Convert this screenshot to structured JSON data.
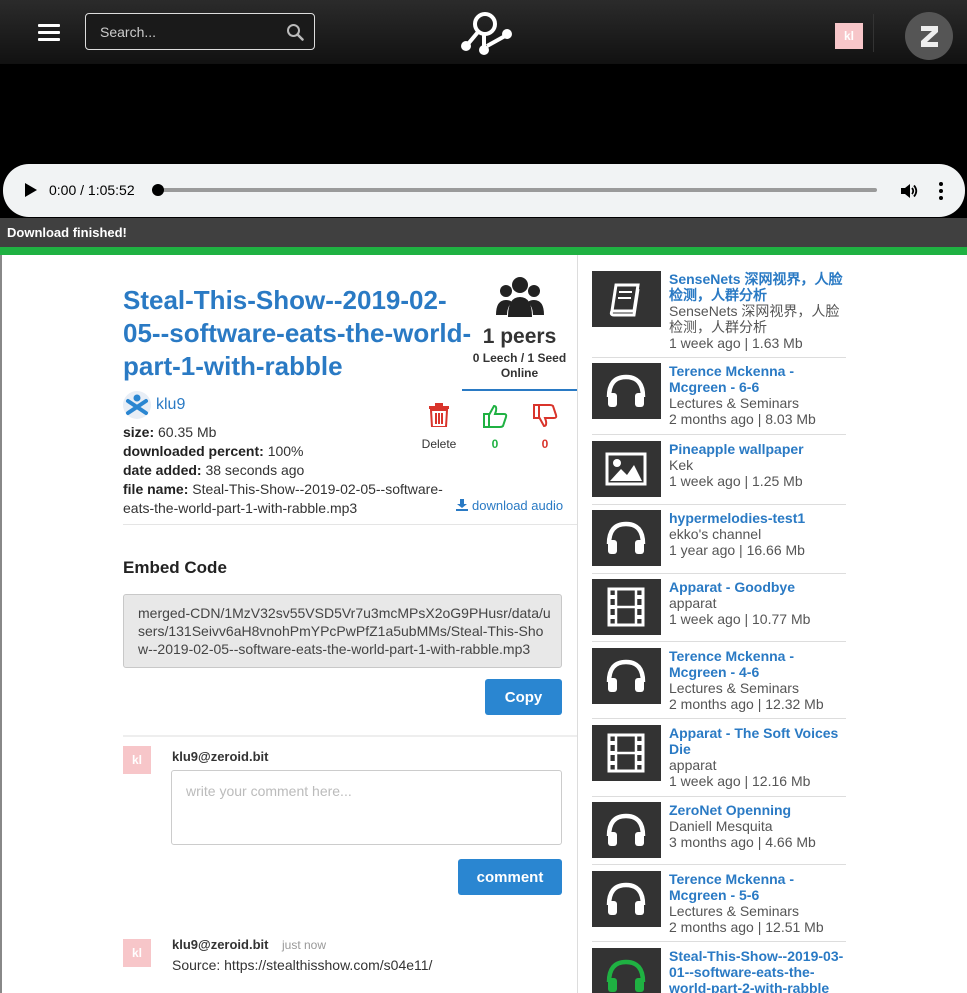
{
  "header": {
    "search_placeholder": "Search...",
    "user_initials": "kl"
  },
  "player": {
    "time": "0:00 / 1:05:52",
    "progress_fraction": 0.0
  },
  "status": {
    "message": "Download finished!",
    "color": "#1fb142"
  },
  "file": {
    "title": "Steal-This-Show--2019-02-05--software-eats-the-world-part-1-with-rabble",
    "author": "klu9",
    "peers": "1 peers",
    "peers_detail": "0 Leech / 1 Seed Online",
    "size_label": "size:",
    "size": "60.35 Mb",
    "percent_label": "downloaded percent:",
    "percent": "100%",
    "date_label": "date added:",
    "date": "38 seconds ago",
    "filename_label": "file name:",
    "filename": "Steal-This-Show--2019-02-05--software-eats-the-world-part-1-with-rabble.mp3"
  },
  "actions": {
    "delete_label": "Delete",
    "likes": "0",
    "dislikes": "0",
    "download_label": "download audio"
  },
  "embed": {
    "heading": "Embed Code",
    "code": "merged-CDN/1MzV32sv55VSD5Vr7u3mcMPsX2oG9PHusr/data/users/131Seivv6aH8vnohPmYPcPwPfZ1a5ubMMs/Steal-This-Show--2019-02-05--software-eats-the-world-part-1-with-rabble.mp3",
    "copy_label": "Copy"
  },
  "comment_form": {
    "avatar": "kl",
    "user": "klu9@zeroid.bit",
    "placeholder": "write your comment here...",
    "button_label": "comment"
  },
  "comments": [
    {
      "avatar": "kl",
      "user": "klu9@zeroid.bit",
      "time": "just now",
      "text": "Source: https://stealthisshow.com/s04e11/"
    }
  ],
  "sidebar": {
    "items": [
      {
        "icon": "book-icon",
        "title": "SenseNets 深网视界，人脸检测，人群分析",
        "sub": "SenseNets 深网视界，人脸检测，人群分析",
        "meta": "1 week ago | 1.63 Mb"
      },
      {
        "icon": "headphones-icon",
        "title": "Terence Mckenna - Mcgreen - 6-6",
        "sub": "Lectures & Seminars",
        "meta": "2 months ago | 8.03 Mb"
      },
      {
        "icon": "image-icon",
        "title": "Pineapple wallpaper",
        "sub": "Kek",
        "meta": "1 week ago | 1.25 Mb"
      },
      {
        "icon": "headphones-icon",
        "title": "hypermelodies-test1",
        "sub": "ekko's channel",
        "meta": "1 year ago | 16.66 Mb"
      },
      {
        "icon": "film-icon",
        "title": "Apparat - Goodbye",
        "sub": "apparat",
        "meta": "1 week ago | 10.77 Mb"
      },
      {
        "icon": "headphones-icon",
        "title": "Terence Mckenna - Mcgreen - 4-6",
        "sub": "Lectures & Seminars",
        "meta": "2 months ago | 12.32 Mb"
      },
      {
        "icon": "film-icon",
        "title": "Apparat - The Soft Voices Die",
        "sub": "apparat",
        "meta": "1 week ago | 12.16 Mb"
      },
      {
        "icon": "headphones-icon",
        "title": "ZeroNet Openning",
        "sub": "Daniell Mesquita",
        "meta": "3 months ago | 4.66 Mb"
      },
      {
        "icon": "headphones-icon",
        "title": "Terence Mckenna - Mcgreen - 5-6",
        "sub": "Lectures & Seminars",
        "meta": "2 months ago | 12.51 Mb"
      },
      {
        "icon": "headphones-icon",
        "title": "Steal-This-Show--2019-03-01--software-eats-the-world-part-2-with-rabble",
        "sub": "",
        "meta": ""
      }
    ]
  }
}
